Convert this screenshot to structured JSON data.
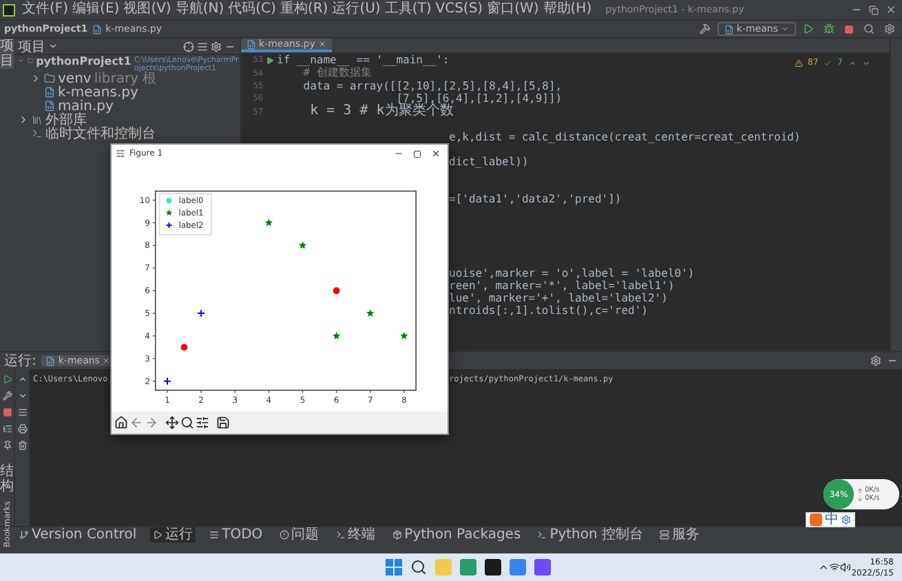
{
  "window": {
    "title": "pythonProject1 - k-means.py",
    "menu": [
      "文件(F)",
      "编辑(E)",
      "视图(V)",
      "导航(N)",
      "代码(C)",
      "重构(R)",
      "运行(U)",
      "工具(T)",
      "VCS(S)",
      "窗口(W)",
      "帮助(H)"
    ]
  },
  "navbar": {
    "breadcrumb": [
      "pythonProject1",
      "k-means.py"
    ],
    "run_config": "k-means"
  },
  "left_strip": {
    "labels": [
      "项目"
    ],
    "bottom_labels": [
      "结构",
      "Bookmarks"
    ]
  },
  "project": {
    "title": "项目",
    "tree": [
      {
        "name": "pythonProject1",
        "path": "C:\\Users\\Lenovo\\PycharmProjects\\pythonProject1",
        "kind": "folder",
        "expanded": true,
        "children": [
          {
            "name": "venv",
            "note": "library 根",
            "kind": "folder",
            "expanded": false
          },
          {
            "name": "k-means.py",
            "kind": "file"
          },
          {
            "name": "main.py",
            "kind": "file"
          }
        ]
      },
      {
        "name": "外部库",
        "kind": "library",
        "expanded": false
      },
      {
        "name": "临时文件和控制台",
        "kind": "console"
      }
    ]
  },
  "editor": {
    "tabs": [
      {
        "label": "k-means.py",
        "selected": true
      }
    ],
    "warnings": "87",
    "passed": "7",
    "lines": [
      {
        "kind": "code",
        "number": "53",
        "text": "if __name__ == '__main__':",
        "run": true
      },
      {
        "kind": "comment",
        "number": "54",
        "text": "    # 创建数据集"
      },
      {
        "kind": "code",
        "number": "55",
        "text": "    data = array([[2,10],[2,5],[8,4],[5,8],"
      },
      {
        "kind": "code",
        "number": "56",
        "text": "                  [7,5],[6,4],[1,2],[4,9]])"
      },
      {
        "kind": "code",
        "number": "57",
        "text": "    k = 3 # k为聚类个数"
      },
      {
        "kind": "covered"
      },
      {
        "kind": "partial",
        "text": "e,k,dist = calc_distance(creat_center=creat_centroid)"
      },
      {
        "kind": "covered"
      },
      {
        "kind": "partial",
        "text": "dict_label))"
      },
      {
        "kind": "covered"
      },
      {
        "kind": "covered"
      },
      {
        "kind": "partial",
        "text": "=['data1','data2','pred'])"
      },
      {
        "kind": "covered"
      },
      {
        "kind": "covered"
      },
      {
        "kind": "covered"
      },
      {
        "kind": "covered"
      },
      {
        "kind": "covered"
      },
      {
        "kind": "partial",
        "text": "uoise',marker = 'o',label = 'label0')"
      },
      {
        "kind": "partial",
        "text": "reen', marker='*', label='label1')"
      },
      {
        "kind": "partial",
        "text": "lue', marker='+', label='label2')"
      },
      {
        "kind": "partial",
        "text": "ntroids[:,1].tolist(),c='red')"
      }
    ]
  },
  "figure": {
    "title": "Figure 1",
    "chart_data": {
      "type": "scatter",
      "legend": "upper left",
      "xlim": [
        0.65,
        8.35
      ],
      "ylim": [
        1.6,
        10.4
      ],
      "xticks": [
        1,
        2,
        3,
        4,
        5,
        6,
        7,
        8
      ],
      "yticks": [
        2,
        3,
        4,
        5,
        6,
        7,
        8,
        9,
        10
      ],
      "series": [
        {
          "name": "label0",
          "color": "#40e0d0",
          "marker": "o"
        },
        {
          "name": "label1",
          "color": "#008000",
          "marker": "*",
          "x": [
            4,
            5,
            6,
            7,
            8
          ],
          "values": [
            9,
            8,
            4,
            5,
            4
          ]
        },
        {
          "name": "label2",
          "color": "#0000ff",
          "marker": "+",
          "x": [
            1,
            2
          ],
          "values": [
            2,
            5
          ]
        },
        {
          "color": "#ff0000",
          "marker": "o",
          "x": [
            1.5,
            6
          ],
          "values": [
            3.5,
            6
          ]
        }
      ]
    }
  },
  "run_panel": {
    "label": "运行:",
    "tabs": [
      {
        "label": "k-means",
        "selected": true
      }
    ],
    "output": [
      "C:\\Users\\Lenovo",
      "rojects/pythonProject1/k-means.py"
    ]
  },
  "tool_windows": [
    {
      "label": "Version Control",
      "selected": false
    },
    {
      "label": "运行",
      "selected": true
    },
    {
      "label": "TODO",
      "selected": false
    },
    {
      "label": "问题",
      "selected": false
    },
    {
      "label": "终端",
      "selected": false
    },
    {
      "label": "Python Packages",
      "selected": false
    },
    {
      "label": "Python 控制台",
      "selected": false
    },
    {
      "label": "服务",
      "selected": false
    }
  ],
  "monitor": {
    "percent": "34%",
    "upload": "0K/s",
    "download": "0K/s"
  },
  "ime": {
    "mode": "中"
  },
  "taskbar": {
    "time": "16:58",
    "date": "2022/5/15"
  }
}
